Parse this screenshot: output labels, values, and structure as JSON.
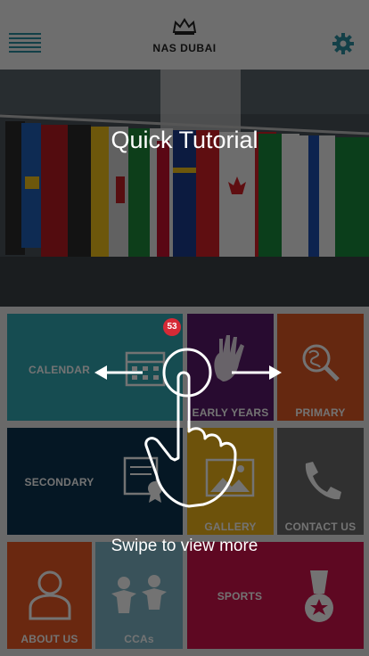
{
  "header": {
    "logo_text": "NAS DUBAI"
  },
  "tutorial": {
    "title": "Quick Tutorial",
    "swipe_hint": "Swipe to view more"
  },
  "calendar_badge": "53",
  "tiles": [
    {
      "label": "CALENDAR",
      "color": "#32a8b4",
      "icon": "calendar-icon"
    },
    {
      "label": "EARLY YEARS",
      "color": "#5a1a6a",
      "icon": "handprint-icon"
    },
    {
      "label": "PRIMARY",
      "color": "#e05a25",
      "icon": "globe-search-icon"
    },
    {
      "label": "SECONDARY",
      "color": "#0d3450",
      "icon": "certificate-icon"
    },
    {
      "label": "GALLERY",
      "color": "#f2b61a",
      "icon": "image-icon"
    },
    {
      "label": "CONTACT US",
      "color": "#6b6b6b",
      "icon": "phone-icon"
    },
    {
      "label": "ABOUT US",
      "color": "#ea5a24",
      "icon": "person-icon"
    },
    {
      "label": "CCAs",
      "color": "#7fb7c8",
      "icon": "people-icon"
    },
    {
      "label": "SPORTS",
      "color": "#d0134c",
      "icon": "medal-icon"
    }
  ]
}
